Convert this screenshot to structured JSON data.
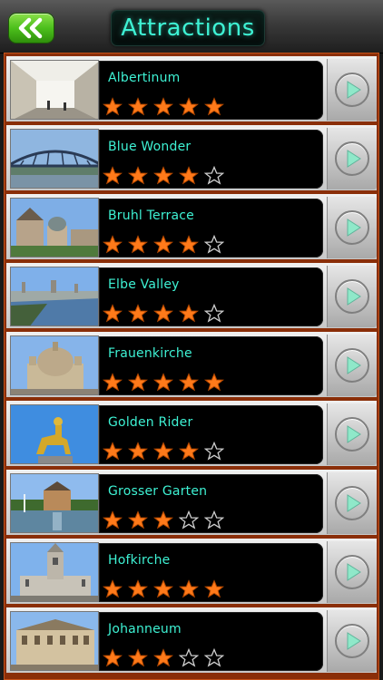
{
  "header": {
    "title": "Attractions",
    "back_icon": "double-chevron-left-icon"
  },
  "colors": {
    "title_glow": "#3ef2d4",
    "back_button_green": "#4cbf1c",
    "star_filled": "#ff7a1a",
    "list_frame": "#8a2e08"
  },
  "attractions": [
    {
      "name": "Albertinum",
      "rating": 5,
      "thumb": "gallery-interior"
    },
    {
      "name": "Blue Wonder",
      "rating": 4,
      "thumb": "steel-bridge"
    },
    {
      "name": "Bruhl Terrace",
      "rating": 4,
      "thumb": "riverside-terrace"
    },
    {
      "name": "Elbe Valley",
      "rating": 4,
      "thumb": "river-valley"
    },
    {
      "name": "Frauenkirche",
      "rating": 5,
      "thumb": "domed-church"
    },
    {
      "name": "Golden Rider",
      "rating": 4,
      "thumb": "golden-statue"
    },
    {
      "name": "Grosser Garten",
      "rating": 3,
      "thumb": "palace-garden"
    },
    {
      "name": "Hofkirche",
      "rating": 5,
      "thumb": "baroque-church"
    },
    {
      "name": "Johanneum",
      "rating": 3,
      "thumb": "historic-building"
    }
  ]
}
